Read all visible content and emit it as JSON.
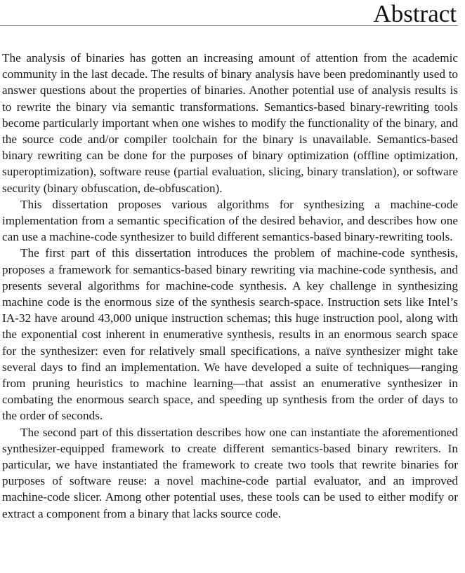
{
  "page": {
    "title": "Abstract",
    "paragraphs": [
      "The analysis of binaries has gotten an increasing amount of attention from the academic community in the last decade.  The results of binary analysis have been predominantly used to answer questions about the properties of binaries.  Another potential use of analysis results is to rewrite the binary via semantic transformations.  Semantics-based binary-rewriting tools become particularly important when one wishes to modify the functionality of the binary, and the source code and/or compiler toolchain for the binary is unavailable. Semantics-based binary rewriting can be done for the purposes of binary optimization (offline optimization, superoptimization), software reuse (partial evaluation, slicing, binary translation), or software security (binary obfuscation, de-obfuscation).",
      "This dissertation proposes various algorithms for synthesizing a machine-code implementation from a semantic specification of the desired behavior, and describes how one can use a machine-code synthesizer to build different semantics-based binary-rewriting tools.",
      "The first part of this dissertation introduces the problem of machine-code synthesis, proposes a framework for semantics-based binary rewriting via machine-code synthesis, and presents several algorithms for machine-code synthesis. A key challenge in synthesizing machine code is the enormous size of the synthesis search-space. Instruction sets like Intel’s IA-32 have around 43,000 unique instruction schemas; this huge instruction pool, along with the exponential cost inherent in enumerative synthesis, results in an enormous search space for the synthesizer: even for relatively small specifications, a naïve synthesizer might take several days to find an implementation.  We have developed a suite of techniques—ranging from pruning heuristics to machine learning—that assist an enumerative synthesizer in combating the enormous search space, and speeding up synthesis from the order of days to the order of seconds.",
      "The second part of this dissertation describes how one can instantiate the aforementioned synthesizer-equipped framework to create different semantics-based binary rewriters.  In particular, we have instantiated the framework to create two tools that rewrite binaries for purposes of software reuse: a novel machine-code partial evaluator, and an improved machine-code slicer.  Among other potential uses, these tools can be used to either modify or extract a component from a binary that lacks source code."
    ]
  }
}
